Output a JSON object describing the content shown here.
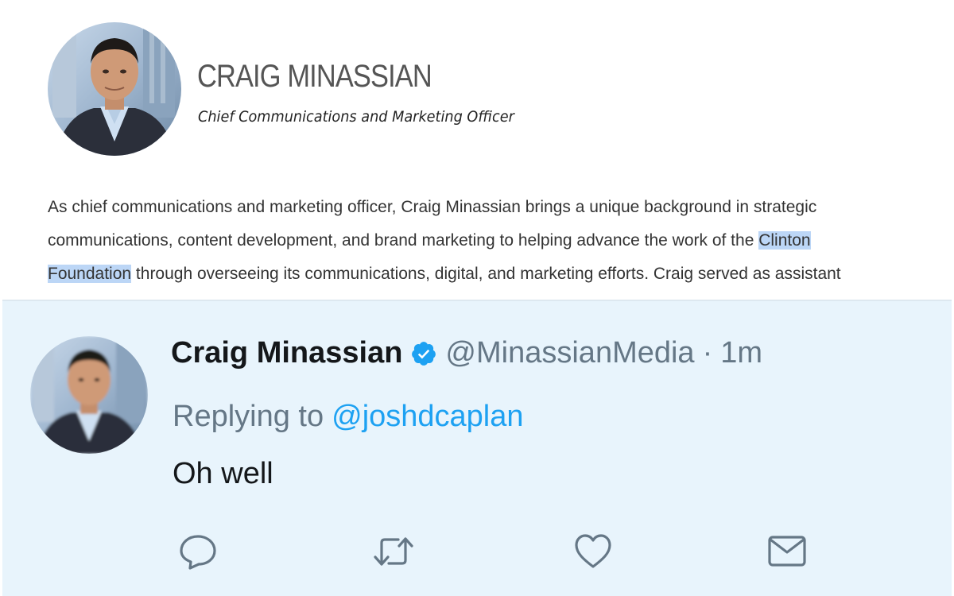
{
  "profile": {
    "name": "CRAIG MINASSIAN",
    "title": "Chief Communications and Marketing Officer",
    "avatar_icon": "person-photo",
    "bio_lines": [
      {
        "before": "As chief communications and marketing officer, Craig Minassian brings a unique background in strategic",
        "highlight": "",
        "after": ""
      },
      {
        "before": "communications, content development, and brand marketing to helping advance the work of the ",
        "highlight": "Clinton",
        "after": ""
      },
      {
        "before": "",
        "highlight": "Foundation",
        "after": " through overseeing its communications, digital, and marketing efforts. Craig served as assistant"
      }
    ],
    "highlight_color": "#bcd6f6"
  },
  "tweet": {
    "author": "Craig Minassian",
    "verified_icon": "verified-badge",
    "handle": "@MinassianMedia",
    "separator": "·",
    "time": "1m",
    "replying_prefix": "Replying to",
    "replying_to": "@joshdcaplan",
    "text": "Oh well",
    "background_color": "#e8f4fc",
    "link_color": "#1da1f2",
    "actions": [
      {
        "name": "reply-icon"
      },
      {
        "name": "retweet-icon"
      },
      {
        "name": "like-icon"
      },
      {
        "name": "message-icon"
      }
    ]
  }
}
